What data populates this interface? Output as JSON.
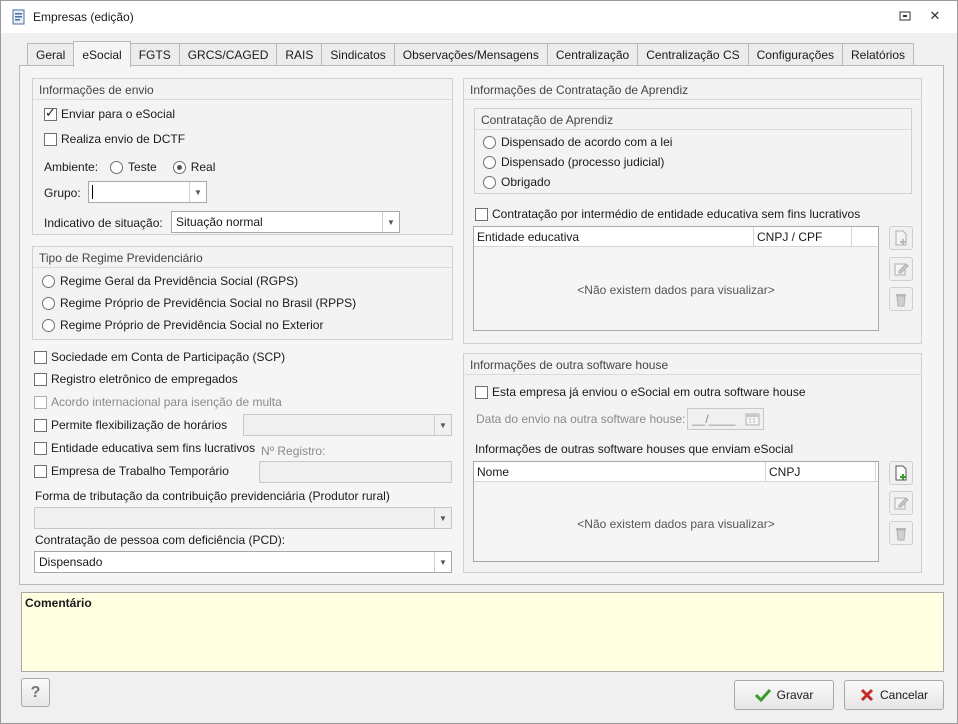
{
  "window": {
    "title": "Empresas (edição)"
  },
  "tabs": [
    "Geral",
    "eSocial",
    "FGTS",
    "GRCS/CAGED",
    "RAIS",
    "Sindicatos",
    "Observações/Mensagens",
    "Centralização",
    "Centralização CS",
    "Configurações",
    "Relatórios"
  ],
  "active_tab": "eSocial",
  "envio": {
    "title": "Informações de envio",
    "enviar_esocial": {
      "label": "Enviar para o eSocial",
      "checked": true
    },
    "dctf": {
      "label": "Realiza envio de DCTF",
      "checked": false
    },
    "ambiente_label": "Ambiente:",
    "ambiente_teste": "Teste",
    "ambiente_real": "Real",
    "ambiente_selected": "Real",
    "grupo_label": "Grupo:",
    "grupo_value": "",
    "situacao_label": "Indicativo de situação:",
    "situacao_value": "Situação normal"
  },
  "regime": {
    "title": "Tipo de Regime Previdenciário",
    "options": [
      "Regime Geral da Previdência Social (RGPS)",
      "Regime Próprio de Previdência Social no Brasil (RPPS)",
      "Regime Próprio de Previdência Social no Exterior"
    ]
  },
  "options": {
    "scp": "Sociedade em Conta de Participação (SCP)",
    "registro_eletronico": "Registro eletrônico de empregados",
    "acordo_internacional": "Acordo internacional para isenção de multa",
    "flexibilizacao": "Permite flexibilização de horários",
    "entidade_educativa": "Entidade educativa sem fins lucrativos",
    "registro_label": "Nº Registro:",
    "trabalho_temporario": "Empresa de Trabalho Temporário",
    "tributacao_label": "Forma de tributação da contribuição previdenciária (Produtor rural)",
    "tributacao_value": "",
    "pcd_label": "Contratação de pessoa com deficiência (PCD):",
    "pcd_value": "Dispensado"
  },
  "aprendiz": {
    "title": "Informações de Contratação de Aprendiz",
    "sub_title": "Contratação de Aprendiz",
    "options": [
      "Dispensado de acordo com a lei",
      "Dispensado (processo judicial)",
      "Obrigado"
    ],
    "intermedio_label": "Contratação por intermédio de entidade educativa sem fins lucrativos",
    "columns": [
      "Entidade educativa",
      "CNPJ / CPF"
    ],
    "empty": "<Não existem dados para visualizar>"
  },
  "software_house": {
    "title": "Informações de outra software house",
    "enviou_label": "Esta empresa já enviou o eSocial em outra software house",
    "data_label": "Data do envio na outra software house:",
    "data_value": "__/____",
    "outras_label": "Informações de outras software houses que enviam eSocial",
    "columns": [
      "Nome",
      "CNPJ"
    ],
    "empty": "<Não existem dados para visualizar>"
  },
  "comment": {
    "label": "Comentário"
  },
  "footer": {
    "help": "?",
    "save": "Gravar",
    "cancel": "Cancelar"
  },
  "colors": {
    "accent_green": "#3a9a2a",
    "cancel_red": "#c62828",
    "comment_bg": "#ffffe1"
  }
}
